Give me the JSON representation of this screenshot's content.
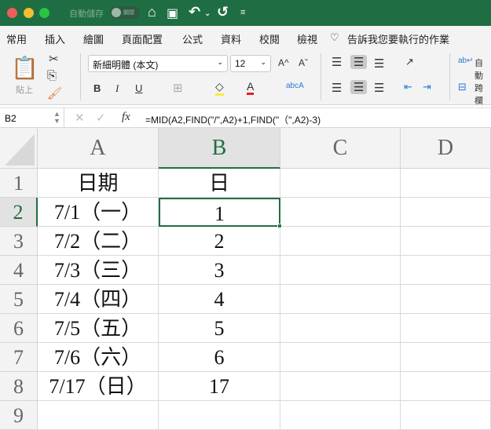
{
  "titlebar": {
    "autosave_label": "自動儲存",
    "autosave_state": "關閉",
    "colors": {
      "close": "#ee5e57",
      "min": "#f5bd2f",
      "max": "#29c440",
      "bar": "#1f6e43"
    }
  },
  "tabs": [
    "常用",
    "插入",
    "繪圖",
    "頁面配置",
    "公式",
    "資料",
    "校閱",
    "檢視"
  ],
  "tell_me": "告訴我您要執行的作業",
  "ribbon": {
    "paste_label": "貼上",
    "font_name": "新細明體 (本文)",
    "font_size": "12",
    "bold": "B",
    "italic": "I",
    "underline": "U",
    "font_color_letter": "A",
    "wrap_label": "自動",
    "merge_label": "跨欄",
    "grow": "A^",
    "shrink": "Aˇ"
  },
  "formula_bar": {
    "name_box": "B2",
    "fx": "fx",
    "formula": "=MID(A2,FIND(\"/\",A2)+1,FIND(\"（\",A2)-3)"
  },
  "columns": [
    "A",
    "B",
    "C",
    "D"
  ],
  "rows": [
    {
      "n": "1",
      "a": "日期",
      "b": "日"
    },
    {
      "n": "2",
      "a": "7/1（一）",
      "b": "1"
    },
    {
      "n": "3",
      "a": "7/2（二）",
      "b": "2"
    },
    {
      "n": "4",
      "a": "7/3（三）",
      "b": "3"
    },
    {
      "n": "5",
      "a": "7/4（四）",
      "b": "4"
    },
    {
      "n": "6",
      "a": "7/5（五）",
      "b": "5"
    },
    {
      "n": "7",
      "a": "7/6（六）",
      "b": "6"
    },
    {
      "n": "8",
      "a": "7/17（日）",
      "b": "17"
    },
    {
      "n": "9",
      "a": "",
      "b": ""
    }
  ]
}
